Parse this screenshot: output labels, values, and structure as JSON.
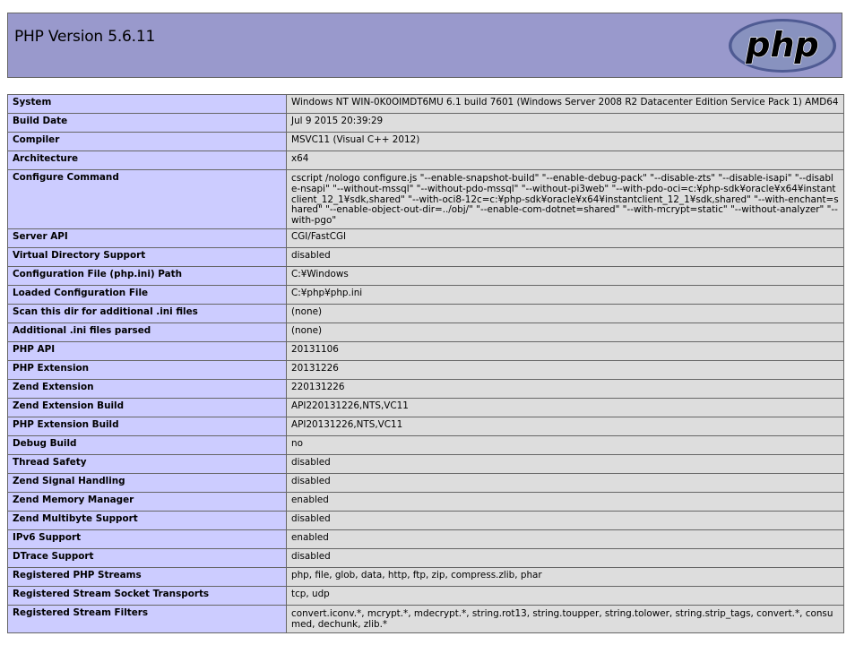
{
  "header": {
    "title": "PHP Version 5.6.11",
    "logo_text": "php"
  },
  "colors": {
    "header_bg": "#9999cc",
    "label_bg": "#ccccff",
    "value_bg": "#dddddd",
    "border": "#666666",
    "logo_bg": "#6c7eb7",
    "logo_text": "#000000"
  },
  "rows": [
    {
      "label": "System",
      "value": "Windows NT WIN-0K0OIMDT6MU 6.1 build 7601 (Windows Server 2008 R2 Datacenter Edition Service Pack 1) AMD64"
    },
    {
      "label": "Build Date",
      "value": "Jul 9 2015 20:39:29"
    },
    {
      "label": "Compiler",
      "value": "MSVC11 (Visual C++ 2012)"
    },
    {
      "label": "Architecture",
      "value": "x64"
    },
    {
      "label": "Configure Command",
      "value": "cscript /nologo configure.js \"--enable-snapshot-build\" \"--enable-debug-pack\" \"--disable-zts\" \"--disable-isapi\" \"--disable-nsapi\" \"--without-mssql\" \"--without-pdo-mssql\" \"--without-pi3web\" \"--with-pdo-oci=c:¥php-sdk¥oracle¥x64¥instantclient_12_1¥sdk,shared\" \"--with-oci8-12c=c:¥php-sdk¥oracle¥x64¥instantclient_12_1¥sdk,shared\" \"--with-enchant=shared\" \"--enable-object-out-dir=../obj/\" \"--enable-com-dotnet=shared\" \"--with-mcrypt=static\" \"--without-analyzer\" \"--with-pgo\""
    },
    {
      "label": "Server API",
      "value": "CGI/FastCGI"
    },
    {
      "label": "Virtual Directory Support",
      "value": "disabled"
    },
    {
      "label": "Configuration File (php.ini) Path",
      "value": "C:¥Windows"
    },
    {
      "label": "Loaded Configuration File",
      "value": "C:¥php¥php.ini"
    },
    {
      "label": "Scan this dir for additional .ini files",
      "value": "(none)"
    },
    {
      "label": "Additional .ini files parsed",
      "value": "(none)"
    },
    {
      "label": "PHP API",
      "value": "20131106"
    },
    {
      "label": "PHP Extension",
      "value": "20131226"
    },
    {
      "label": "Zend Extension",
      "value": "220131226"
    },
    {
      "label": "Zend Extension Build",
      "value": "API220131226,NTS,VC11"
    },
    {
      "label": "PHP Extension Build",
      "value": "API20131226,NTS,VC11"
    },
    {
      "label": "Debug Build",
      "value": "no"
    },
    {
      "label": "Thread Safety",
      "value": "disabled"
    },
    {
      "label": "Zend Signal Handling",
      "value": "disabled"
    },
    {
      "label": "Zend Memory Manager",
      "value": "enabled"
    },
    {
      "label": "Zend Multibyte Support",
      "value": "disabled"
    },
    {
      "label": "IPv6 Support",
      "value": "enabled"
    },
    {
      "label": "DTrace Support",
      "value": "disabled"
    },
    {
      "label": "Registered PHP Streams",
      "value": "php, file, glob, data, http, ftp, zip, compress.zlib, phar"
    },
    {
      "label": "Registered Stream Socket Transports",
      "value": "tcp, udp"
    },
    {
      "label": "Registered Stream Filters",
      "value": "convert.iconv.*, mcrypt.*, mdecrypt.*, string.rot13, string.toupper, string.tolower, string.strip_tags, convert.*, consumed, dechunk, zlib.*"
    }
  ]
}
